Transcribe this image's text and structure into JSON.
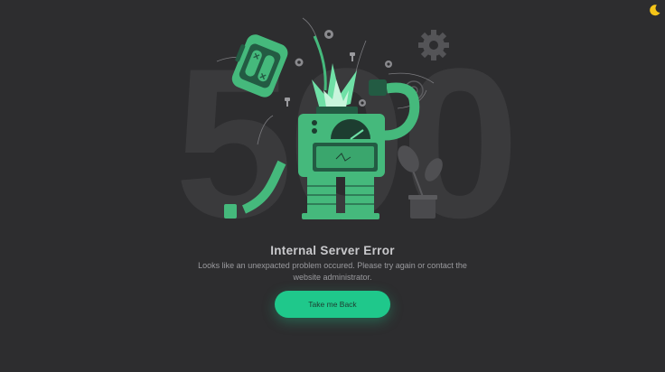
{
  "background_digits": "500",
  "error": {
    "title": "Internal Server Error",
    "message": "Looks like an unexpacted problem occured. Please try again or contact the website administrator."
  },
  "back_button": {
    "label": "Take me Back"
  },
  "icons": {
    "theme_toggle": "moon-icon",
    "gear": "gear-icon",
    "robot": "robot-illustration",
    "plant": "plant-icon"
  },
  "colors": {
    "background": "#2d2d2f",
    "accent": "#1fc88b",
    "robot_green": "#45b97c",
    "robot_dark": "#235b43",
    "digits": "#3a3a3c",
    "moon": "#f5c518"
  }
}
